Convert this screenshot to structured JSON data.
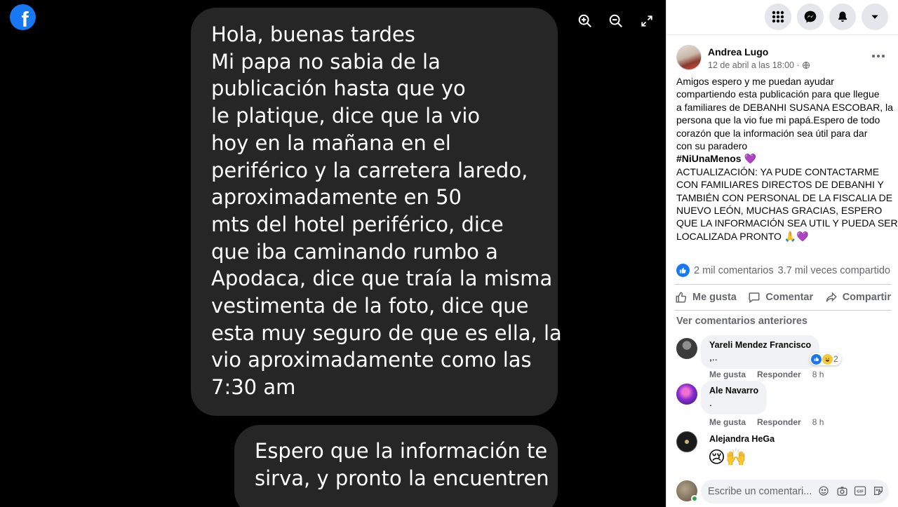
{
  "viewer": {
    "logo_letter": "f",
    "tools": {
      "zoom_in": "zoom-in-icon",
      "zoom_out": "zoom-out-icon",
      "fullscreen": "expand-icon"
    },
    "message_1_lines": [
      "Hola, buenas tardes",
      "Mi papa no sabia de la",
      "publicación hasta que yo",
      "le platique, dice que la vio",
      "hoy en la mañana en el",
      "periférico y la carretera laredo,",
      "aproximadamente en 50",
      "mts del hotel periférico, dice",
      "que iba caminando rumbo a",
      "Apodaca, dice que traía la misma",
      "vestimenta de la foto, dice que",
      "esta muy seguro de que es ella, la",
      "vio aproximadamente como las",
      "7:30 am"
    ],
    "message_2_lines": [
      "Espero que la información te",
      "sirva, y pronto la encuentren"
    ]
  },
  "sidebar": {
    "top_icons": [
      "menu-grid-icon",
      "messenger-icon",
      "notifications-bell-icon",
      "account-caret-icon"
    ],
    "post": {
      "author": "Andrea Lugo",
      "timestamp": "12 de abril a las 18:00 ·",
      "privacy_icon": "globe-icon",
      "body_lines": [
        "Amigos espero y me puedan ayudar",
        "compartiendo esta publicación para que llegue",
        "a familiares de DEBANHI SUSANA ESCOBAR, la",
        "persona que la vio fue mi papá.Espero de todo",
        "corazón que la información sea útil para dar",
        "con su paradero"
      ],
      "hashtag": "#NiUnaMenos",
      "hashtag_emoji": "💜",
      "update_lines": [
        "ACTUALIZACIÓN: YA PUDE CONTACTARME",
        "CON FAMILIARES DIRECTOS DE DEBANHI Y",
        "TAMBIÉN CON PERSONAL DE LA FISCALIA DE",
        "NUEVO LEÓN, MUCHAS GRACIAS, ESPERO",
        "QUE LA INFORMACIÓN SEA UTIL Y PUEDA SER"
      ],
      "update_last": "LOCALIZADA PRONTO",
      "update_last_emoji": "🙏💜",
      "comments_count": "2 mil comentarios",
      "shares_count": "3.7 mil veces compartido"
    },
    "actions": {
      "like": "Me gusta",
      "comment": "Comentar",
      "share": "Compartir"
    },
    "prev_comments": "Ver comentarios anteriores",
    "comments": [
      {
        "name": "Yareli Mendez Francisco",
        "text": ",..",
        "reactions": "2",
        "like": "Me gusta",
        "reply": "Responder",
        "time": "8 h"
      },
      {
        "name": "Ale Navarro",
        "text": ".",
        "like": "Me gusta",
        "reply": "Responder",
        "time": "8 h"
      },
      {
        "name": "Alejandra HeGa",
        "emojis": "😢🙌"
      }
    ],
    "write_placeholder": "Escribe un comentari...",
    "write_tools": [
      "emoji-icon",
      "camera-icon",
      "gif-icon",
      "sticker-icon"
    ]
  },
  "colors": {
    "accent": "#1877f2",
    "bubble": "#262626",
    "secondary_text": "#65676b",
    "comment_bg": "#f0f2f5"
  }
}
